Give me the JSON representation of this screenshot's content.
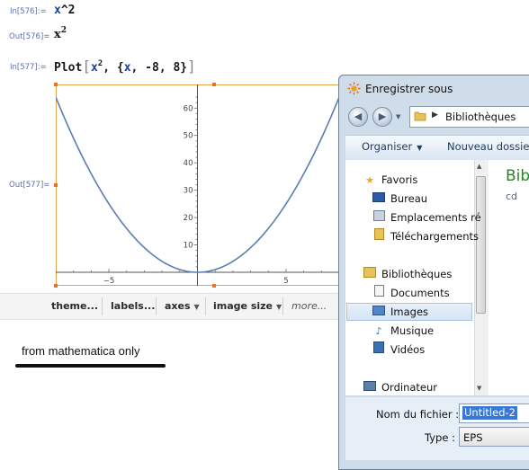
{
  "notebook": {
    "cells": [
      {
        "in_label": "In[576]:=",
        "input_var": "x",
        "input_rest": "^2"
      },
      {
        "out_label": "Out[576]=",
        "output_base": "x",
        "output_exp": "2"
      },
      {
        "in_label": "In[577]:=",
        "plot_func": "Plot",
        "plot_open": "[",
        "plot_var": "x",
        "plot_exp": "2",
        "plot_range_open": ", {",
        "plot_range_var": "x",
        "plot_range_vals": ", -8, 8}",
        "plot_close": "]"
      },
      {
        "out_label": "Out[577]="
      }
    ],
    "toolbar": {
      "items": [
        "theme...",
        "labels...",
        "axes",
        "image size",
        "more..."
      ]
    },
    "note": "from mathematica only"
  },
  "chart_data": {
    "type": "line",
    "function": "x^2",
    "x": [
      -8,
      -7,
      -6,
      -5,
      -4,
      -3,
      -2,
      -1,
      0,
      1,
      2,
      3,
      4,
      5,
      6,
      7,
      8
    ],
    "y": [
      64,
      49,
      36,
      25,
      16,
      9,
      4,
      1,
      0,
      1,
      4,
      9,
      16,
      25,
      36,
      49,
      64
    ],
    "xlim": [
      -8,
      8
    ],
    "ylim": [
      0,
      66
    ],
    "x_ticks": [
      -5,
      5
    ],
    "y_ticks": [
      10,
      20,
      30,
      40,
      50,
      60
    ],
    "x_tick_labels": [
      "−5",
      "5"
    ],
    "y_tick_labels": [
      "10",
      "20",
      "30",
      "40",
      "50",
      "60"
    ],
    "line_color": "#5b7cb5",
    "grid": false
  },
  "dialog": {
    "title": "Enregistrer sous",
    "breadcrumb": "Bibliothèques",
    "commands": {
      "organize": "Organiser",
      "new_folder": "Nouveau dossier"
    },
    "nav_items": [
      {
        "label": "Favoris",
        "icon": "star-icon"
      },
      {
        "label": "Bureau",
        "icon": "desktop-icon"
      },
      {
        "label": "Emplacements ré",
        "icon": "recent-places-icon"
      },
      {
        "label": "Téléchargements",
        "icon": "downloads-icon"
      },
      {
        "label": "Bibliothèques",
        "icon": "libraries-icon"
      },
      {
        "label": "Documents",
        "icon": "documents-icon"
      },
      {
        "label": "Images",
        "icon": "images-icon"
      },
      {
        "label": "Musique",
        "icon": "music-icon"
      },
      {
        "label": "Vidéos",
        "icon": "videos-icon"
      },
      {
        "label": "Ordinateur",
        "icon": "computer-icon"
      }
    ],
    "content": {
      "title": "Bib",
      "subtitle": "cd"
    },
    "filename_label": "Nom du fichier :",
    "filename_value": "Untitled-2",
    "filetype_label": "Type :",
    "filetype_value": "EPS"
  }
}
